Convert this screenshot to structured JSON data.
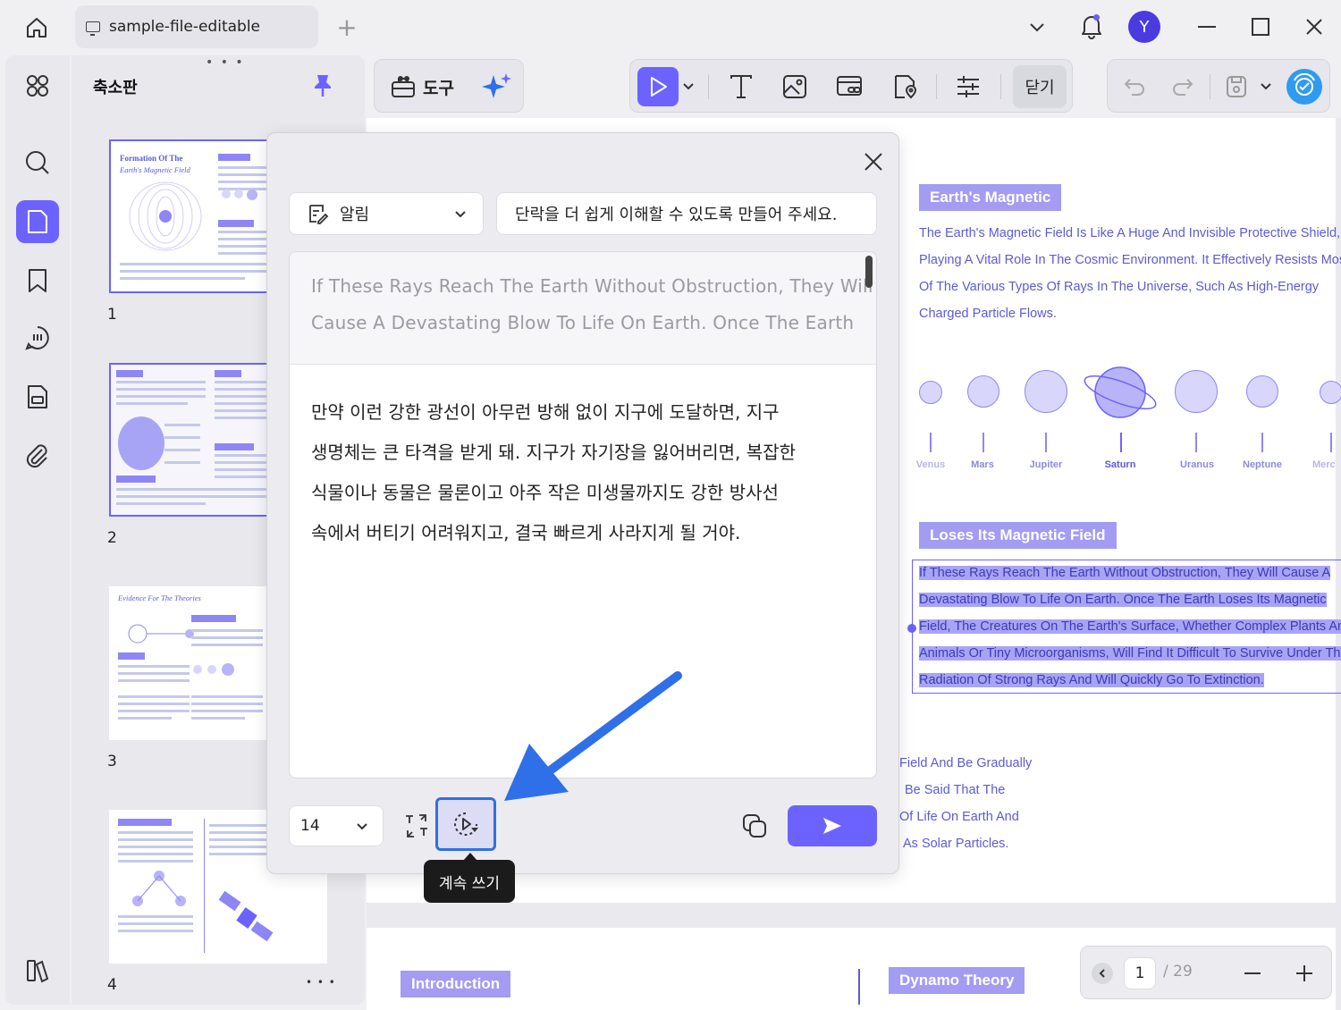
{
  "window": {
    "file_tab": "sample-file-editable",
    "avatar_initial": "Y"
  },
  "thumbnails": {
    "title": "축소판",
    "handle": "• • •",
    "pages": [
      {
        "number": "1",
        "heading": "Formation Of The",
        "subheading": "Earth's Magnetic Field"
      },
      {
        "number": "2"
      },
      {
        "number": "3",
        "heading": "Evidence For The Theories"
      },
      {
        "number": "4"
      }
    ],
    "more": "• • •"
  },
  "toolbar": {
    "tools_label": "도구",
    "close_label": "닫기"
  },
  "dialog": {
    "mode": "알림",
    "prompt": "단락을 더 쉽게 이해할 수 있도록 만들어 주세요.",
    "source_lines": [
      "If These Rays Reach The Earth Without Obstruction, They Will",
      "Cause A Devastating Blow To Life On Earth. Once The Earth"
    ],
    "output_lines": [
      "만약 이런 강한 광선이 아무런 방해 없이 지구에 도달하면, 지구",
      "생명체는 큰 타격을 받게 돼. 지구가 자기장을 잃어버리면, 복잡한",
      "식물이나 동물은 물론이고 아주 작은 미생물까지도 강한 방사선",
      "속에서 버티기 어려워지고, 결국 빠르게 사라지게 될 거야."
    ],
    "font_size": "14",
    "tooltip": "계속 쓰기"
  },
  "document": {
    "section1_title": "Earth's Magnetic",
    "section1_lines": [
      "The Earth's Magnetic Field Is Like A Huge And Invisible Protective Shield,",
      "Playing A Vital Role In The Cosmic Environment. It Effectively Resists Most",
      "Of The Various Types Of Rays In The Universe, Such As High-Energy",
      "Charged Particle Flows."
    ],
    "planets": [
      "Venus",
      "Mars",
      "Jupiter",
      "Saturn",
      "Uranus",
      "Neptune",
      "Merc"
    ],
    "section2_title": "Loses Its Magnetic Field",
    "selected_lines": [
      "If These Rays Reach The Earth Without Obstruction, They Will Cause A",
      "Devastating Blow To Life On Earth. Once The Earth Loses Its Magnetic",
      "Field, The Creatures On The Earth's Surface, Whether Complex Plants And",
      "Animals Or Tiny Microorganisms, Will Find It Difficult To Survive Under The",
      "Radiation Of Strong Rays And Will Quickly Go To Extinction."
    ],
    "partial_lines": [
      "Field And Be Gradually",
      "Be Said That The",
      "Of Life On Earth And",
      "As Solar Particles."
    ],
    "page2_tag1": "Introduction",
    "page2_tag2": "Dynamo Theory"
  },
  "pager": {
    "current": "1",
    "total": "/ 29"
  },
  "colors": {
    "accent": "#6c63ff",
    "highlight": "#a8a4f5",
    "arrow": "#2f6fe8"
  }
}
